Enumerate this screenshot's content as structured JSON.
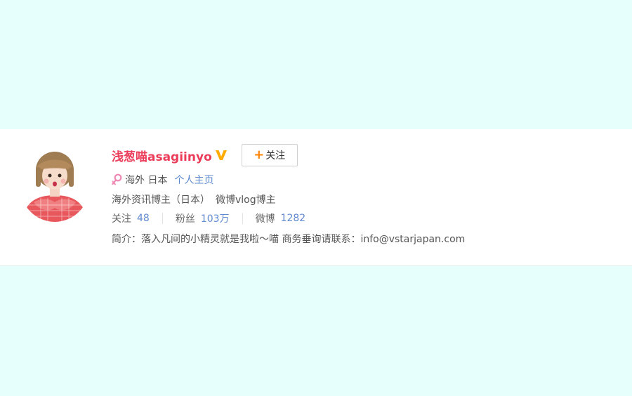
{
  "profile": {
    "name": "浅葱喵asagiinyo",
    "verified_icon": "verified-v-badge-icon",
    "follow_button": {
      "plus": "+",
      "label": "关注"
    },
    "gender_icon": "female-icon",
    "location": "海外 日本",
    "homepage_link": "个人主页",
    "tags": [
      "海外资讯博主（日本）",
      "微博vlog博主"
    ],
    "stats": [
      {
        "label": "关注",
        "value": "48"
      },
      {
        "label": "粉丝",
        "value": "103万"
      },
      {
        "label": "微博",
        "value": "1282"
      }
    ],
    "bio": "简介：落入凡间的小精灵就是我啦～喵 商务垂询请联系：info@vstarjapan.com"
  },
  "colors": {
    "page_background": "#e6fffd",
    "name": "#eb3c5a",
    "link": "#5f8ad0",
    "verified": "#ffab00",
    "follow_plus": "#ff8200"
  }
}
